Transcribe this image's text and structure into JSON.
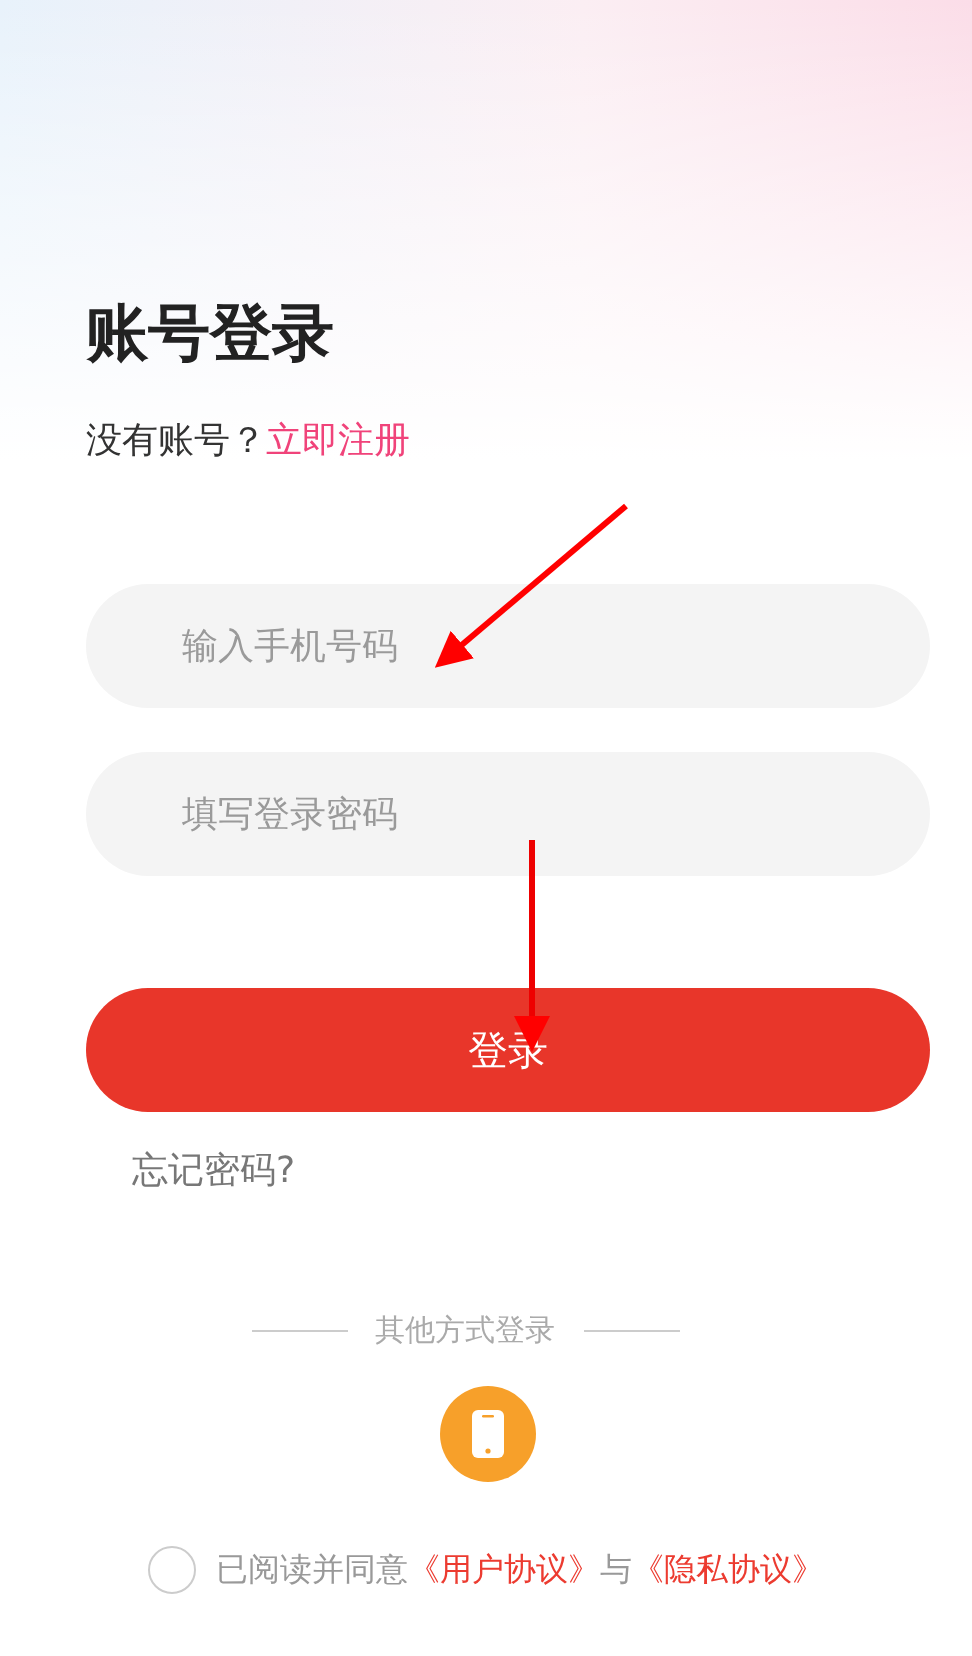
{
  "title": "账号登录",
  "register_prompt": {
    "text": "没有账号？",
    "link": "立即注册"
  },
  "fields": [
    {
      "placeholder": "输入手机号码"
    },
    {
      "placeholder": "填写登录密码"
    }
  ],
  "login_button": "登录",
  "forgot_password": "忘记密码?",
  "other_login": {
    "label": "其他方式登录",
    "methods": [
      {
        "kind": "phone"
      }
    ]
  },
  "agreement": {
    "checked": false,
    "text": "已阅读并同意",
    "links": [
      "《用户协议》",
      "《隐私协议》"
    ],
    "joiner": "与"
  }
}
